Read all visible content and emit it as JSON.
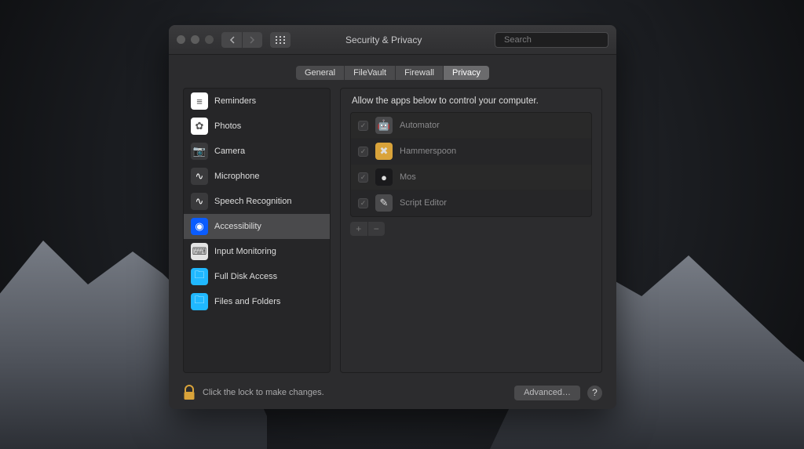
{
  "window": {
    "title": "Security & Privacy"
  },
  "toolbar": {
    "search_placeholder": "Search"
  },
  "tabs": [
    {
      "label": "General",
      "active": false
    },
    {
      "label": "FileVault",
      "active": false
    },
    {
      "label": "Firewall",
      "active": false
    },
    {
      "label": "Privacy",
      "active": true
    }
  ],
  "sidebar": {
    "categories": [
      {
        "label": "Reminders",
        "icon": "reminders-icon",
        "icon_bg": "#ffffff",
        "icon_glyph": "≡",
        "selected": false
      },
      {
        "label": "Photos",
        "icon": "photos-icon",
        "icon_bg": "#ffffff",
        "icon_glyph": "✿",
        "selected": false
      },
      {
        "label": "Camera",
        "icon": "camera-icon",
        "icon_bg": "#3a3a3c",
        "icon_glyph": "📷",
        "selected": false
      },
      {
        "label": "Microphone",
        "icon": "microphone-icon",
        "icon_bg": "#3a3a3c",
        "icon_glyph": "∿",
        "selected": false
      },
      {
        "label": "Speech Recognition",
        "icon": "speech-recognition-icon",
        "icon_bg": "#3a3a3c",
        "icon_glyph": "∿",
        "selected": false
      },
      {
        "label": "Accessibility",
        "icon": "accessibility-icon",
        "icon_bg": "#0a5cff",
        "icon_glyph": "◉",
        "selected": true
      },
      {
        "label": "Input Monitoring",
        "icon": "input-monitoring-icon",
        "icon_bg": "#e4e4e4",
        "icon_glyph": "⌨",
        "selected": false
      },
      {
        "label": "Full Disk Access",
        "icon": "full-disk-access-icon",
        "icon_bg": "#20b8ff",
        "icon_glyph": "🗀",
        "selected": false
      },
      {
        "label": "Files and Folders",
        "icon": "files-and-folders-icon",
        "icon_bg": "#20b8ff",
        "icon_glyph": "🗀",
        "selected": false
      }
    ]
  },
  "main": {
    "heading": "Allow the apps below to control your computer.",
    "apps": [
      {
        "name": "Automator",
        "checked": true,
        "icon": "automator-icon",
        "icon_bg": "#4a4a4c",
        "icon_glyph": "🤖"
      },
      {
        "name": "Hammerspoon",
        "checked": true,
        "icon": "hammerspoon-icon",
        "icon_bg": "#d9a33a",
        "icon_glyph": "✖"
      },
      {
        "name": "Mos",
        "checked": true,
        "icon": "mos-icon",
        "icon_bg": "#1a1a1c",
        "icon_glyph": "●"
      },
      {
        "name": "Script Editor",
        "checked": true,
        "icon": "script-editor-icon",
        "icon_bg": "#4a4a4c",
        "icon_glyph": "✎"
      }
    ],
    "add_label": "+",
    "remove_label": "−"
  },
  "footer": {
    "lock_text": "Click the lock to make changes.",
    "advanced_label": "Advanced…",
    "help_label": "?"
  }
}
